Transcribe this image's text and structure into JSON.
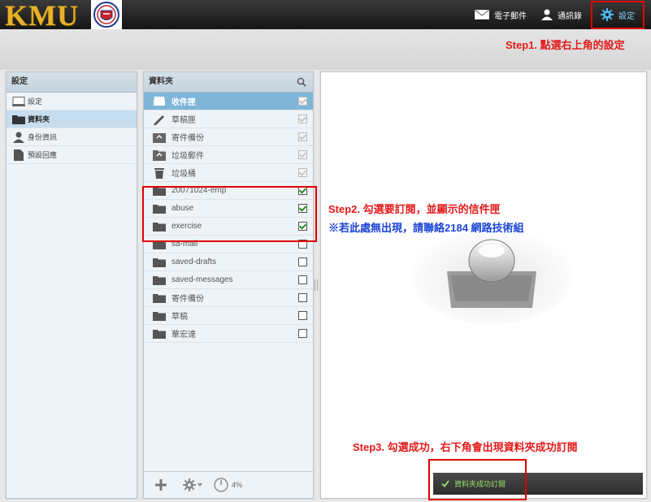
{
  "brand": {
    "logo_text": "KMU"
  },
  "topnav": {
    "mail_label": "電子郵件",
    "contacts_label": "通訊錄",
    "settings_label": "設定"
  },
  "notes": {
    "step1": "Step1. 點選右上角的設定",
    "step2": "Step2. 勾選要訂閱，並顯示的信件匣",
    "step2_sub": "※若此處無出現，請聯絡2184 網路技術組",
    "step3": "Step3. 勾選成功，右下角會出現資料夾成功訂閱"
  },
  "settings_panel": {
    "title": "設定",
    "items": [
      {
        "label": "設定",
        "icon": "monitor-icon",
        "selected": false
      },
      {
        "label": "資料夾",
        "icon": "folder-icon",
        "selected": true
      },
      {
        "label": "身份資訊",
        "icon": "user-icon",
        "selected": false
      },
      {
        "label": "預設回應",
        "icon": "document-icon",
        "selected": false
      }
    ]
  },
  "folders_panel": {
    "title": "資料夾",
    "folders": [
      {
        "label": "收件匣",
        "icon": "inbox-icon",
        "checked": true,
        "disabled": true,
        "selected": true
      },
      {
        "label": "草稿匣",
        "icon": "pencil-icon",
        "checked": true,
        "disabled": true,
        "selected": false
      },
      {
        "label": "寄件備份",
        "icon": "sent-icon",
        "checked": true,
        "disabled": true,
        "selected": false
      },
      {
        "label": "垃圾郵件",
        "icon": "junk-icon",
        "checked": true,
        "disabled": true,
        "selected": false
      },
      {
        "label": "垃圾桶",
        "icon": "trash-icon",
        "checked": true,
        "disabled": true,
        "selected": false
      },
      {
        "label": "20071024-emp",
        "icon": "folder-icon",
        "checked": true,
        "disabled": false,
        "selected": false
      },
      {
        "label": "abuse",
        "icon": "folder-icon",
        "checked": true,
        "disabled": false,
        "selected": false
      },
      {
        "label": "exercise",
        "icon": "folder-icon",
        "checked": true,
        "disabled": false,
        "selected": false
      },
      {
        "label": "sa-mail",
        "icon": "folder-icon",
        "checked": false,
        "disabled": false,
        "selected": false
      },
      {
        "label": "saved-drafts",
        "icon": "folder-icon",
        "checked": false,
        "disabled": false,
        "selected": false
      },
      {
        "label": "saved-messages",
        "icon": "folder-icon",
        "checked": false,
        "disabled": false,
        "selected": false
      },
      {
        "label": "寄件備份",
        "icon": "folder-icon",
        "checked": false,
        "disabled": false,
        "selected": false
      },
      {
        "label": "草稿",
        "icon": "folder-icon",
        "checked": false,
        "disabled": false,
        "selected": false
      },
      {
        "label": "華宏達",
        "icon": "folder-icon",
        "checked": false,
        "disabled": false,
        "selected": false
      }
    ],
    "quota": "4%"
  },
  "toast": {
    "message": "資料夾成功訂閱"
  },
  "colors": {
    "accent_blue": "#7fb6d8",
    "note_red": "#e31a1a",
    "note_blue": "#1a44d6",
    "logo_gold": "#e8b12a"
  }
}
